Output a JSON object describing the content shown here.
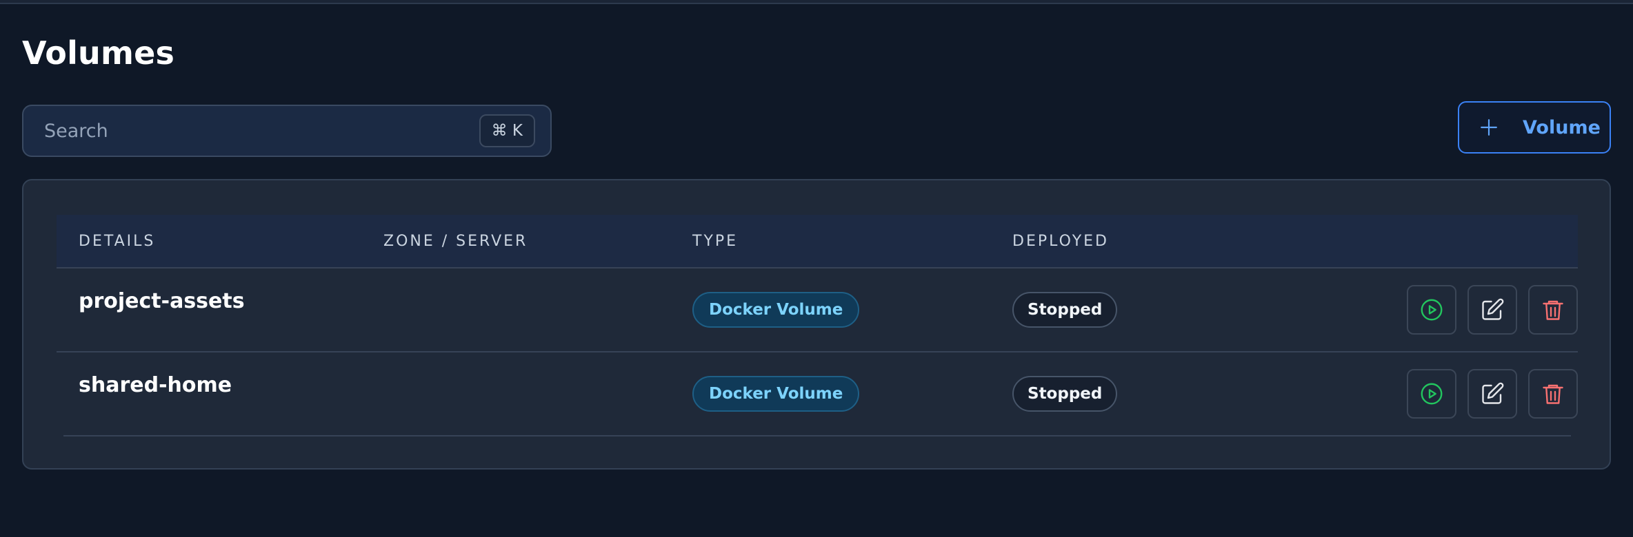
{
  "page": {
    "title": "Volumes"
  },
  "search": {
    "placeholder": "Search",
    "value": "",
    "shortcut": "⌘ K"
  },
  "toolbar": {
    "add_label": "Volume"
  },
  "table": {
    "columns": [
      "DETAILS",
      "ZONE / SERVER",
      "TYPE",
      "DEPLOYED"
    ],
    "rows": [
      {
        "name": "project-assets",
        "zone": "",
        "type": "Docker Volume",
        "deployed": "Stopped"
      },
      {
        "name": "shared-home",
        "zone": "",
        "type": "Docker Volume",
        "deployed": "Stopped"
      }
    ]
  },
  "icons": {
    "add": "plus-icon",
    "start": "play-circle-icon",
    "edit": "pencil-square-icon",
    "delete": "trash-icon"
  },
  "colors": {
    "background": "#0f1827",
    "accent": "#3b82f6",
    "start": "#22c55e",
    "delete": "#f87171",
    "type_badge": "#7dd3fc"
  }
}
